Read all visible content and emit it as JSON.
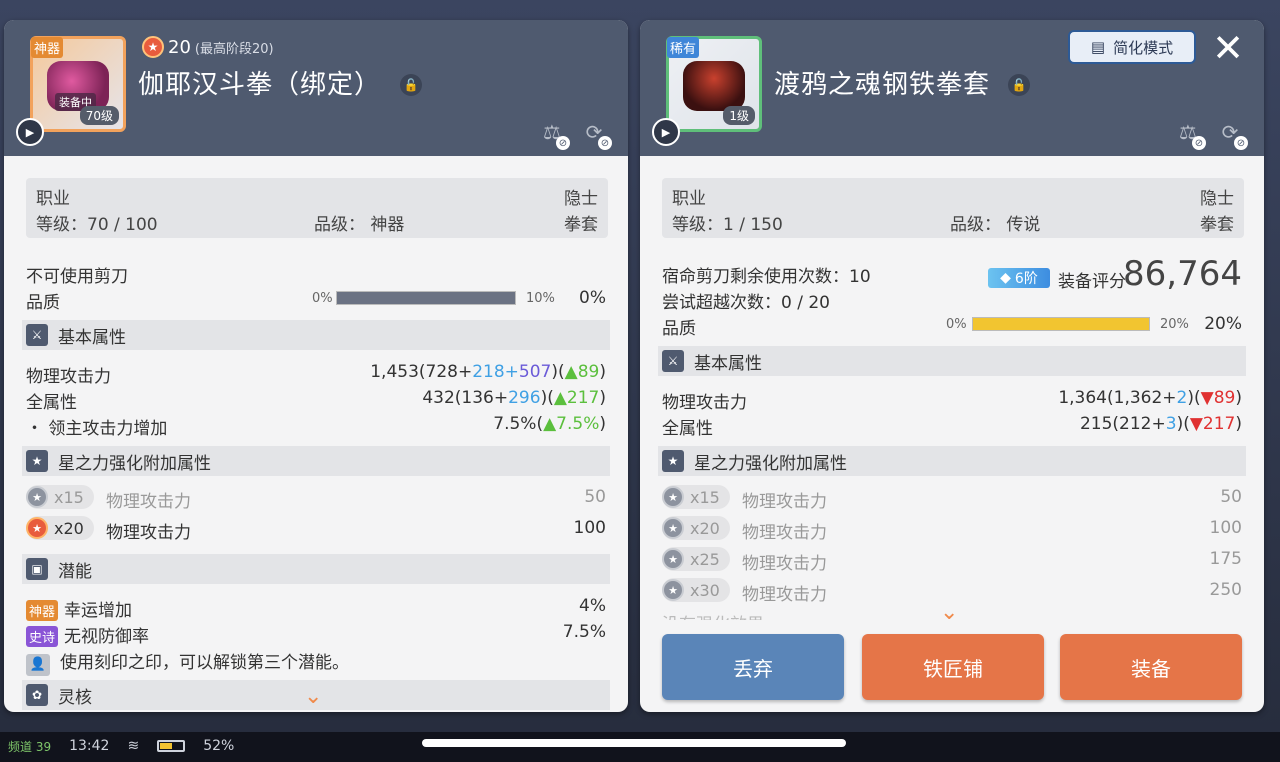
{
  "left": {
    "grade_tag": "神器",
    "equipped_tag": "装备中",
    "level_tag": "70级",
    "star_level": "20",
    "star_max": "(最高阶段20)",
    "name": "伽耶汉斗拳（绑定）",
    "info": {
      "job_label": "职业",
      "job_value": "隐士",
      "level": "等级：70 / 100",
      "grade": "品级：  神器",
      "type": "拳套"
    },
    "scissors": "不可使用剪刀",
    "quality_label": "品质",
    "quality_min": "0%",
    "quality_max": "10%",
    "quality_value": "0%",
    "quality_fill": 1.0,
    "basic_section": "基本属性",
    "stats": [
      {
        "name": "物理攻击力",
        "pre": "1,453(728+",
        "a": "218",
        "plus": "+",
        "b": "507",
        "post": ")(",
        "delta": "▲89",
        "end": ")"
      },
      {
        "name": "全属性",
        "pre": "432(136+",
        "a": "296",
        "plus": "",
        "b": "",
        "post": ")(",
        "delta": "▲217",
        "end": ")"
      },
      {
        "name": "・ 领主攻击力增加",
        "pre": "7.5%(",
        "a": "",
        "plus": "",
        "b": "",
        "post": "",
        "delta": "▲7.5%",
        "end": ")"
      }
    ],
    "star_section": "星之力强化附加属性",
    "star_rows": [
      {
        "badge": "x15",
        "name": "物理攻击力",
        "value": "50"
      },
      {
        "badge": "x20",
        "name": "物理攻击力",
        "value": "100"
      }
    ],
    "potential_section": "潜能",
    "potentials": [
      {
        "tag": "神器",
        "name": "幸运增加",
        "value": "4%"
      },
      {
        "tag": "史诗",
        "name": "无视防御率",
        "value": "7.5%"
      }
    ],
    "potential_note": "使用刻印之印，可以解锁第三个潜能。",
    "core_section": "灵核"
  },
  "right": {
    "grade_tag": "稀有",
    "level_tag": "1级",
    "name": "渡鸦之魂钢铁拳套",
    "simple_mode": "简化模式",
    "close": "✕",
    "info": {
      "job_label": "职业",
      "job_value": "隐士",
      "level": "等级：1 / 150",
      "grade": "品级：  传说",
      "type": "拳套"
    },
    "scissors": "宿命剪刀剩余使用次数：10",
    "transcend": "尝试超越次数：0 / 20",
    "grade_chip": "6阶",
    "score_label": "装备评分",
    "score_value": "86,764",
    "quality_label": "品质",
    "quality_min": "0%",
    "quality_max": "20%",
    "quality_value": "20%",
    "quality_fill": 1.0,
    "basic_section": "基本属性",
    "stats": [
      {
        "name": "物理攻击力",
        "pre": "1,364(1,362+",
        "a": "2",
        "post": ")(",
        "delta": "▼89",
        "end": ")"
      },
      {
        "name": "全属性",
        "pre": "215(212+",
        "a": "3",
        "post": ")(",
        "delta": "▼217",
        "end": ")"
      }
    ],
    "star_section": "星之力强化附加属性",
    "star_rows": [
      {
        "badge": "x15",
        "name": "物理攻击力",
        "value": "50"
      },
      {
        "badge": "x20",
        "name": "物理攻击力",
        "value": "100"
      },
      {
        "badge": "x25",
        "name": "物理攻击力",
        "value": "175"
      },
      {
        "badge": "x30",
        "name": "物理攻击力",
        "value": "250"
      }
    ],
    "fade_text": "没有强化效果",
    "buttons": {
      "discard": "丢弃",
      "smith": "铁匠铺",
      "equip": "装备"
    }
  },
  "status": {
    "channel": "频道 39",
    "time": "13:42",
    "battery": "52%"
  },
  "colors": {
    "header": "#4f5a6f",
    "accent_orange": "#e57548",
    "accent_blue": "#5a85b8",
    "up": "#5bbf3d",
    "down": "#e03131"
  }
}
